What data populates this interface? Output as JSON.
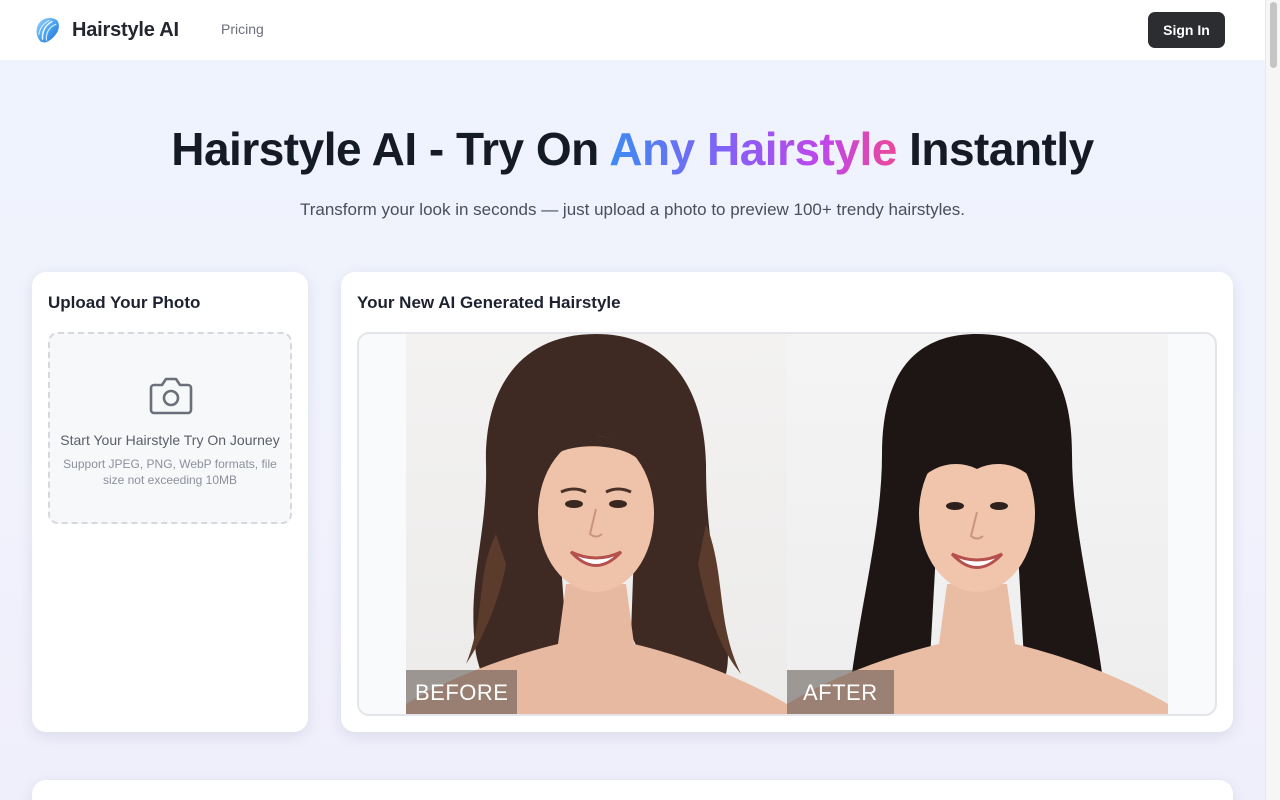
{
  "header": {
    "brand": "Hairstyle AI",
    "nav": [
      {
        "label": "Pricing"
      }
    ],
    "signin_label": "Sign In"
  },
  "hero": {
    "title_part1": "Hairstyle AI - Try On ",
    "title_highlight": "Any Hairstyle",
    "title_part2": " Instantly",
    "subtitle": "Transform your look in seconds — just upload a photo to preview 100+ trendy hairstyles."
  },
  "upload": {
    "title": "Upload Your Photo",
    "dropzone_title": "Start Your Hairstyle Try On Journey",
    "dropzone_hint": "Support JPEG, PNG, WebP formats, file size not exceeding 10MB",
    "icon": "camera-icon"
  },
  "result": {
    "title": "Your New AI Generated Hairstyle",
    "before_label": "BEFORE",
    "after_label": "AFTER"
  },
  "colors": {
    "accent_gradient": [
      "#3d8bf2",
      "#8b5cf6",
      "#ec4899"
    ],
    "signin_bg": "#2c2d31"
  }
}
